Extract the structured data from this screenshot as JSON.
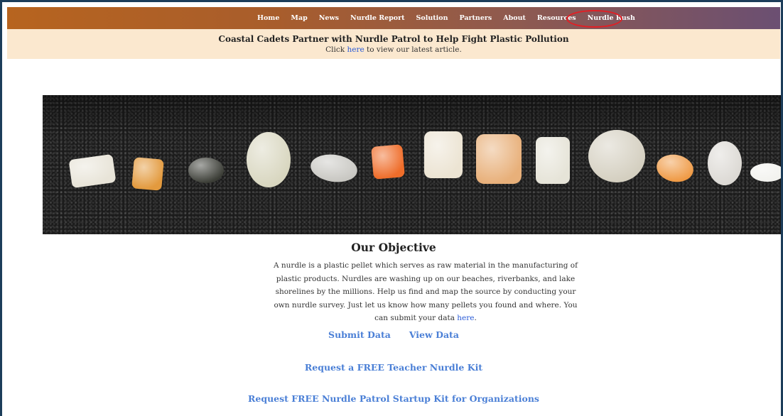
{
  "nav": {
    "items": [
      {
        "label": "Home"
      },
      {
        "label": "Map"
      },
      {
        "label": "News"
      },
      {
        "label": "Nurdle Report"
      },
      {
        "label": "Solution"
      },
      {
        "label": "Partners"
      },
      {
        "label": "About"
      },
      {
        "label": "Resources"
      },
      {
        "label": "Nurdle Rush"
      }
    ],
    "highlighted": "Nurdle Rush",
    "highlight_color": "#e31e24"
  },
  "banner": {
    "headline": "Coastal Cadets Partner with Nurdle Patrol to Help Fight Plastic Pollution",
    "sub_prefix": "Click ",
    "sub_link": "here",
    "sub_suffix": " to view our latest article."
  },
  "hero": {
    "alt": "nurdles-on-black-sand",
    "pellet_colors": [
      "#e8e4d8",
      "#e39a3e",
      "#3b3d36",
      "#d8d6bf",
      "#c8c7c2",
      "#ef6d2a",
      "#ece4d3",
      "#e8b07a",
      "#e6e4d8",
      "#d4cfc0",
      "#ef9a45",
      "#dcd9d4",
      "#f2f2ee"
    ]
  },
  "objective": {
    "title": "Our Objective",
    "text": "A nurdle is a plastic pellet which serves as raw material in the manufacturing of plastic products. Nurdles are washing up on our beaches, riverbanks, and lake shorelines by the millions. Help us find and map the source by conducting your own nurdle survey. Just let us know how many pellets you found and where. You can submit your data ",
    "link": "here",
    "end": "."
  },
  "links": {
    "submit_data": "Submit Data",
    "view_data": "View Data",
    "teacher_kit": "Request a FREE Teacher Nurdle Kit",
    "org_kit": "Request FREE Nurdle Patrol Startup Kit for Organizations"
  },
  "colors": {
    "link": "#4a7fd6",
    "banner_bg": "#fbe8cf",
    "frame": "#1c3d5a"
  }
}
